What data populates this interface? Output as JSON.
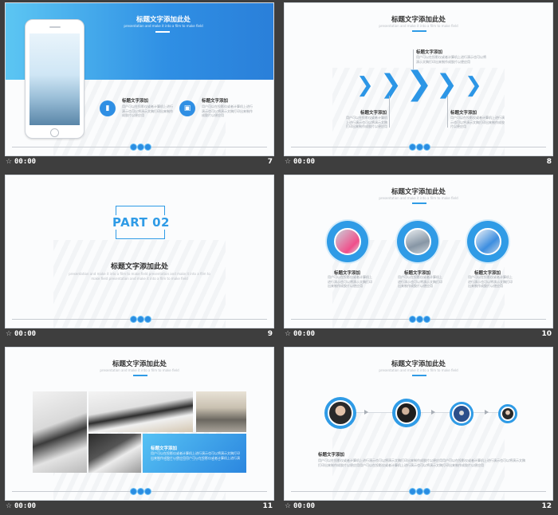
{
  "slides": [
    {
      "number": "7",
      "time": "00:00",
      "title": "标题文字添加此处",
      "subtitle": "presentation and make it into a film to make field",
      "items": [
        {
          "title": "标题文字添加",
          "text": "用户可以在投影仪或者计算机上进行演示也可以将演示文稿打印出来制作成胶片以便应用"
        },
        {
          "title": "标题文字添加",
          "text": "用户可以在投影仪或者计算机上进行演示也可以将演示文稿打印出来制作成胶片以便应用"
        }
      ]
    },
    {
      "number": "8",
      "time": "00:00",
      "title": "标题文字添加此处",
      "subtitle": "presentation and make it into a film to make field",
      "items": [
        {
          "title": "标题文字添加",
          "text": "用户可以在投影仪或者计算机上进行演示也可以将演示文稿打印出来制作成胶片以便应用"
        },
        {
          "title": "标题文字添加",
          "text": "用户可以在投影仪或者计算机上进行演示也可以将演示文稿打印出来制作成胶片以便应用"
        },
        {
          "title": "标题文字添加",
          "text": "用户可以在投影仪或者计算机上进行演示也可以将演示文稿打印出来制作成胶片以便应用"
        }
      ]
    },
    {
      "number": "9",
      "time": "00:00",
      "part": "PART 02",
      "title": "标题文字添加此处",
      "subtitle": "presentation and make it into a film to make field presentation and make it into a film to make field presentation and make it into a film to make field"
    },
    {
      "number": "10",
      "time": "00:00",
      "title": "标题文字添加此处",
      "subtitle": "presentation and make it into a film to make field",
      "items": [
        {
          "title": "标题文字添加",
          "text": "用户可以在投影仪或者计算机上进行演示也可以将演示文稿打印出来制作成胶片以便应用"
        },
        {
          "title": "标题文字添加",
          "text": "用户可以在投影仪或者计算机上进行演示也可以将演示文稿打印出来制作成胶片以便应用"
        },
        {
          "title": "标题文字添加",
          "text": "用户可以在投影仪或者计算机上进行演示也可以将演示文稿打印出来制作成胶片以便应用"
        }
      ]
    },
    {
      "number": "11",
      "time": "00:00",
      "title": "标题文字添加此处",
      "subtitle": "presentation and make it into a film to make field",
      "items": [
        {
          "title": "标题文字添加",
          "text": "用户可以在投影仪或者计算机上进行演示也可以将演示文稿打印出来制作成胶片以便应用用户可以在投影仪或者计算机上进行演示也可以将演示文稿打印出来制作成胶片以便应用"
        }
      ]
    },
    {
      "number": "12",
      "time": "00:00",
      "title": "标题文字添加此处",
      "subtitle": "presentation and make it into a film to make field",
      "items": [
        {
          "title": "标题文字添加",
          "text": "用户可以在投影仪或者计算机上进行演示也可以将演示文稿打印出来制作成胶片以便应用用户可以在投影仪或者计算机上进行演示也可以将演示文稿打印出来制作成胶片以便应用用户可以在投影仪或者计算机上进行演示也可以将演示文稿打印出来制作成胶片以便应用"
        }
      ]
    }
  ],
  "icons": {
    "slide_timer": "star-icon",
    "chevron": "chevron-right-icon"
  },
  "colors": {
    "accent": "#2f9be6",
    "background": "#3e3e3e"
  }
}
